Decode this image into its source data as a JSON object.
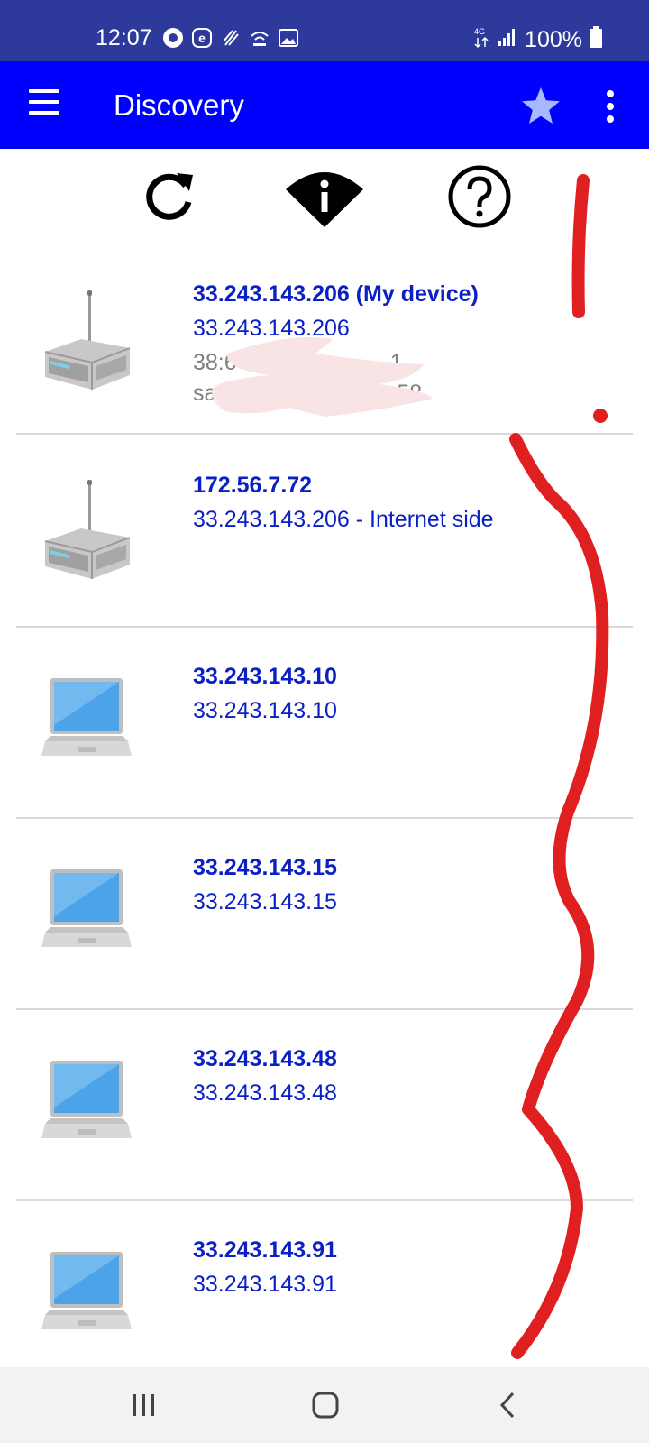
{
  "status_bar": {
    "time": "12:07",
    "battery": "100%"
  },
  "app_bar": {
    "title": "Discovery"
  },
  "toolbar": {
    "refresh_icon": "refresh-icon",
    "wifi_info_icon": "wifi-info-icon",
    "help_icon": "help-icon"
  },
  "devices": [
    {
      "type": "router",
      "name": "33.243.143.206  (My device)",
      "ip": "33.243.143.206",
      "mac_partial": "38:6",
      "mac_tail": "1",
      "host_partial": "sa",
      "host_tail": "58"
    },
    {
      "type": "router",
      "name": "172.56.7.72",
      "ip": "33.243.143.206 - Internet side"
    },
    {
      "type": "laptop",
      "name": "33.243.143.10",
      "ip": "33.243.143.10"
    },
    {
      "type": "laptop",
      "name": "33.243.143.15",
      "ip": "33.243.143.15"
    },
    {
      "type": "laptop",
      "name": "33.243.143.48",
      "ip": "33.243.143.48"
    },
    {
      "type": "laptop",
      "name": "33.243.143.91",
      "ip": "33.243.143.91"
    }
  ],
  "colors": {
    "status_bar": "#2d3a9c",
    "app_bar": "#0000ff",
    "device_text": "#0a1fc4",
    "annotation": "#e02020"
  }
}
